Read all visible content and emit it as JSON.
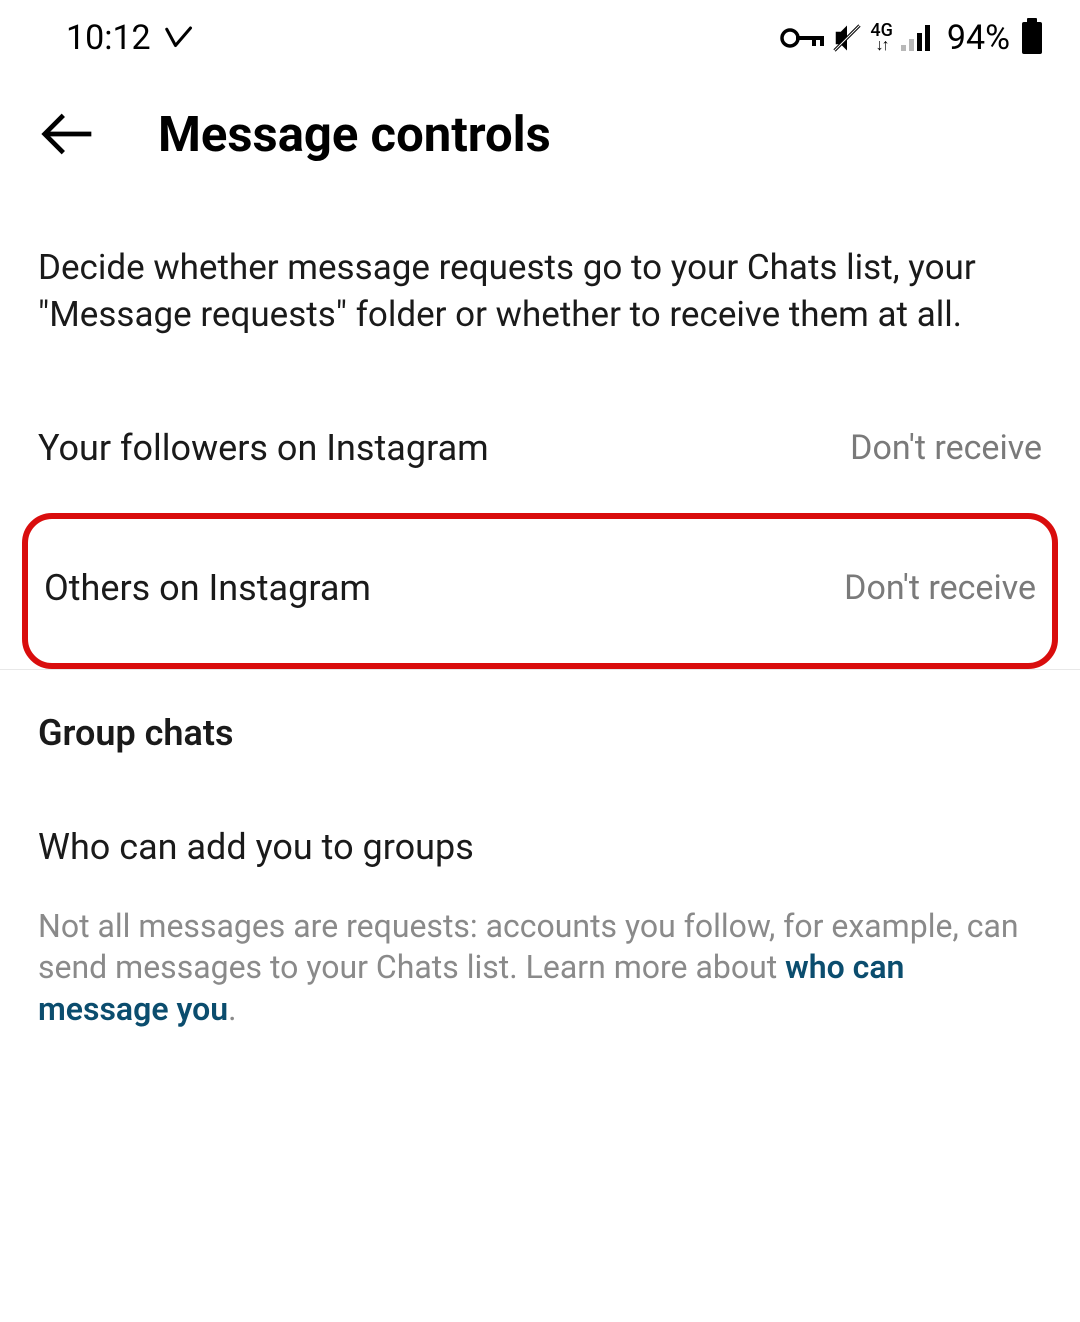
{
  "status": {
    "time": "10:12",
    "network": "4G",
    "battery": "94%"
  },
  "header": {
    "title": "Message controls"
  },
  "description": "Decide whether message requests go to your Chats list, your \"Message requests\" folder or whether to receive them at all.",
  "settings": {
    "followers": {
      "label": "Your followers on Instagram",
      "value": "Don't receive"
    },
    "others": {
      "label": "Others on Instagram",
      "value": "Don't receive"
    }
  },
  "group_section": {
    "header": "Group chats",
    "who_can_add": "Who can add you to groups"
  },
  "info": {
    "text_before": "Not all messages are requests: accounts you follow, for example, can send messages to your Chats list. Learn more about ",
    "link_text": "who can message you",
    "text_after": "."
  }
}
